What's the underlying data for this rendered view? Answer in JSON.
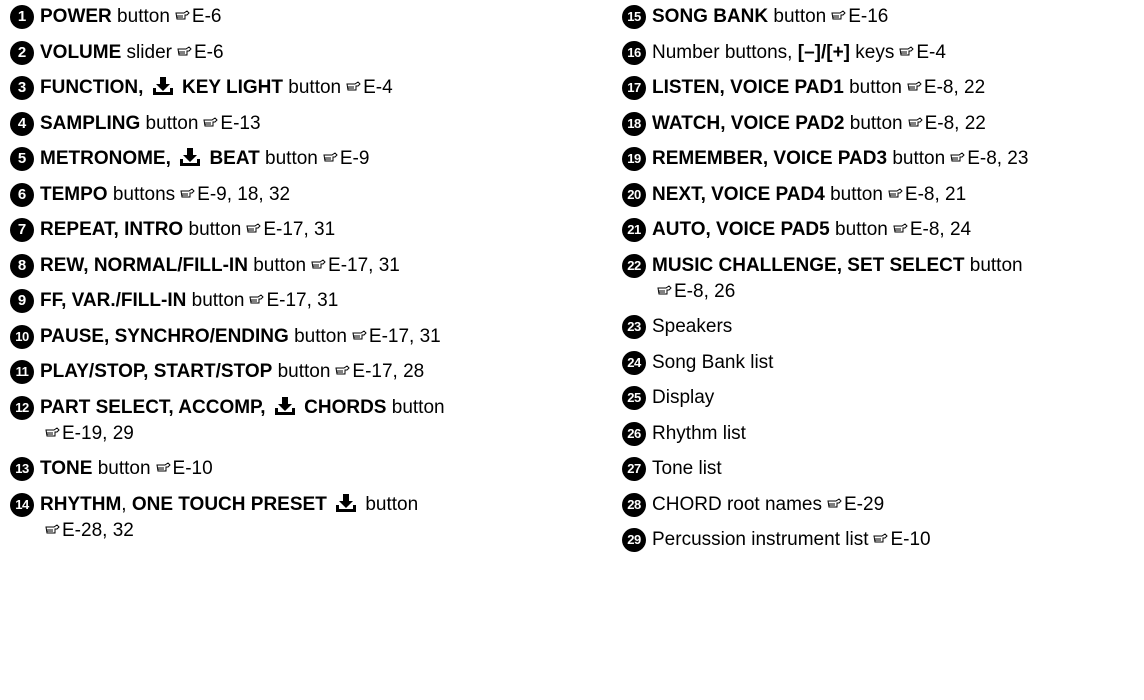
{
  "columns": [
    {
      "items": [
        {
          "num": "1",
          "parts": [
            {
              "t": "POWER",
              "b": true
            },
            {
              "t": " button",
              "b": false
            }
          ],
          "ref": "E-6"
        },
        {
          "num": "2",
          "parts": [
            {
              "t": "VOLUME",
              "b": true
            },
            {
              "t": " slider",
              "b": false
            }
          ],
          "ref": "E-6"
        },
        {
          "num": "3",
          "parts": [
            {
              "t": "FUNCTION, ",
              "b": true
            },
            {
              "icon": "download-icon"
            },
            {
              "t": " KEY LIGHT",
              "b": true
            },
            {
              "t": " button",
              "b": false
            }
          ],
          "ref": "E-4"
        },
        {
          "num": "4",
          "parts": [
            {
              "t": "SAMPLING",
              "b": true
            },
            {
              "t": " button",
              "b": false
            }
          ],
          "ref": "E-13"
        },
        {
          "num": "5",
          "parts": [
            {
              "t": "METRONOME, ",
              "b": true
            },
            {
              "icon": "download-icon"
            },
            {
              "t": " BEAT",
              "b": true
            },
            {
              "t": " button",
              "b": false
            }
          ],
          "ref": "E-9"
        },
        {
          "num": "6",
          "parts": [
            {
              "t": "TEMPO",
              "b": true
            },
            {
              "t": " buttons",
              "b": false
            }
          ],
          "ref": "E-9, 18, 32"
        },
        {
          "num": "7",
          "parts": [
            {
              "t": "REPEAT, INTRO",
              "b": true
            },
            {
              "t": " button",
              "b": false
            }
          ],
          "ref": "E-17, 31"
        },
        {
          "num": "8",
          "parts": [
            {
              "t": "REW, NORMAL/FILL-IN",
              "b": true
            },
            {
              "t": " button",
              "b": false
            }
          ],
          "ref": "E-17, 31"
        },
        {
          "num": "9",
          "parts": [
            {
              "t": "FF, VAR./FILL-IN",
              "b": true
            },
            {
              "t": " button",
              "b": false
            }
          ],
          "ref": "E-17, 31"
        },
        {
          "num": "10",
          "parts": [
            {
              "t": "PAUSE, SYNCHRO/ENDING",
              "b": true
            },
            {
              "t": " button",
              "b": false
            }
          ],
          "ref": "E-17, 31"
        },
        {
          "num": "11",
          "parts": [
            {
              "t": "PLAY/STOP, START/STOP",
              "b": true
            },
            {
              "t": " button",
              "b": false
            }
          ],
          "ref": "E-17, 28"
        },
        {
          "num": "12",
          "parts": [
            {
              "t": "PART SELECT, ACCOMP, ",
              "b": true
            },
            {
              "icon": "download-icon"
            },
            {
              "t": " CHORDS",
              "b": true
            },
            {
              "t": " button",
              "b": false
            },
            {
              "br": true
            }
          ],
          "ref": "E-19, 29"
        },
        {
          "num": "13",
          "parts": [
            {
              "t": "TONE",
              "b": true
            },
            {
              "t": " button",
              "b": false
            }
          ],
          "ref": "E-10"
        },
        {
          "num": "14",
          "parts": [
            {
              "t": "RHYTHM",
              "b": true
            },
            {
              "t": ", ",
              "b": false
            },
            {
              "t": "ONE TOUCH PRESET ",
              "b": true
            },
            {
              "icon": "download-icon"
            },
            {
              "t": " button",
              "b": false
            },
            {
              "br": true
            }
          ],
          "ref": "E-28, 32"
        }
      ]
    },
    {
      "items": [
        {
          "num": "15",
          "parts": [
            {
              "t": "SONG BANK",
              "b": true
            },
            {
              "t": " button",
              "b": false
            }
          ],
          "ref": "E-16"
        },
        {
          "num": "16",
          "parts": [
            {
              "t": "Number buttons, ",
              "b": false
            },
            {
              "t": "[–]/[+]",
              "b": true
            },
            {
              "t": " keys",
              "b": false
            }
          ],
          "ref": "E-4"
        },
        {
          "num": "17",
          "parts": [
            {
              "t": "LISTEN, VOICE PAD1",
              "b": true
            },
            {
              "t": " button",
              "b": false
            }
          ],
          "ref": "E-8, 22"
        },
        {
          "num": "18",
          "parts": [
            {
              "t": "WATCH, VOICE PAD2",
              "b": true
            },
            {
              "t": " button",
              "b": false
            }
          ],
          "ref": "E-8, 22"
        },
        {
          "num": "19",
          "parts": [
            {
              "t": "REMEMBER, VOICE PAD3",
              "b": true
            },
            {
              "t": " button",
              "b": false
            }
          ],
          "ref": "E-8, 23"
        },
        {
          "num": "20",
          "parts": [
            {
              "t": "NEXT, VOICE PAD4",
              "b": true
            },
            {
              "t": " button",
              "b": false
            }
          ],
          "ref": "E-8, 21"
        },
        {
          "num": "21",
          "parts": [
            {
              "t": "AUTO, VOICE PAD5",
              "b": true
            },
            {
              "t": " button",
              "b": false
            }
          ],
          "ref": "E-8, 24"
        },
        {
          "num": "22",
          "parts": [
            {
              "t": "MUSIC CHALLENGE, SET SELECT",
              "b": true
            },
            {
              "t": " button",
              "b": false
            },
            {
              "br": true
            }
          ],
          "ref": "E-8, 26"
        },
        {
          "num": "23",
          "parts": [
            {
              "t": "Speakers",
              "b": false
            }
          ]
        },
        {
          "num": "24",
          "parts": [
            {
              "t": "Song Bank list",
              "b": false
            }
          ]
        },
        {
          "num": "25",
          "parts": [
            {
              "t": "Display",
              "b": false
            }
          ]
        },
        {
          "num": "26",
          "parts": [
            {
              "t": "Rhythm list",
              "b": false
            }
          ]
        },
        {
          "num": "27",
          "parts": [
            {
              "t": "Tone list",
              "b": false
            }
          ]
        },
        {
          "num": "28",
          "parts": [
            {
              "t": "CHORD root names",
              "b": false
            }
          ],
          "ref": "E-29"
        },
        {
          "num": "29",
          "parts": [
            {
              "t": "Percussion instrument list",
              "b": false
            }
          ],
          "ref": "E-10"
        }
      ]
    }
  ]
}
